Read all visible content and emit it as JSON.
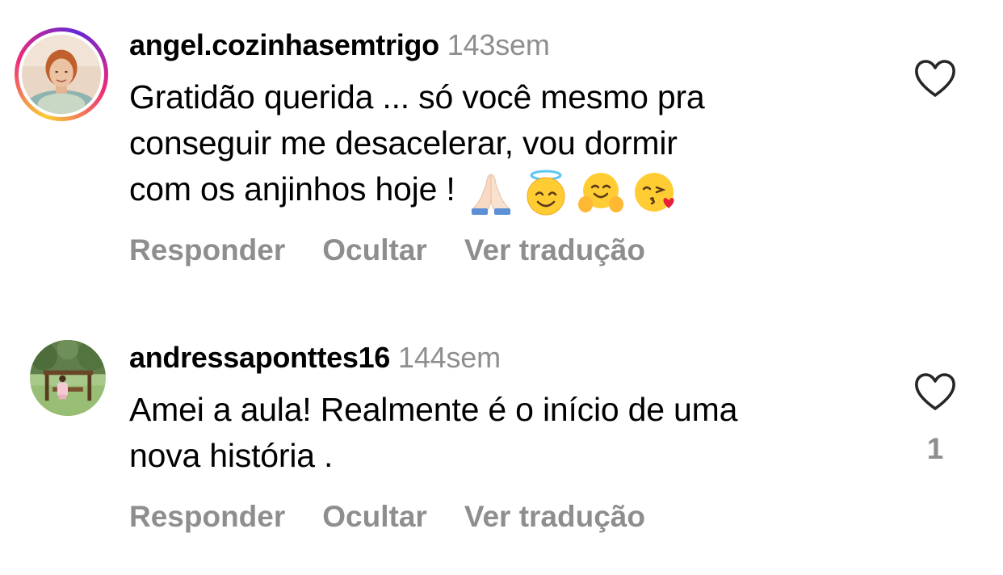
{
  "comments": [
    {
      "username": "angel.cozinhasemtrigo",
      "time": "143sem",
      "has_story_ring": true,
      "text_lines": [
        "Gratidão querida ... só você mesmo pra",
        "conseguir me desacelerar, vou dormir",
        "com os anjinhos hoje !"
      ],
      "emojis": [
        "folded-hands-emoji",
        "smiling-face-with-halo-emoji",
        "hugging-face-emoji",
        "face-blowing-kiss-emoji"
      ],
      "actions": {
        "reply": "Responder",
        "hide": "Ocultar",
        "translate": "Ver tradução"
      },
      "liked": false,
      "like_count": ""
    },
    {
      "username": "andressaponttes16",
      "time": "144sem",
      "has_story_ring": false,
      "text_lines": [
        "Amei a aula! Realmente é o início de uma",
        "nova história ."
      ],
      "emojis": [],
      "actions": {
        "reply": "Responder",
        "hide": "Ocultar",
        "translate": "Ver tradução"
      },
      "liked": false,
      "like_count": "1"
    }
  ],
  "colors": {
    "text": "#000000",
    "secondary": "#8e8e8e",
    "background": "#ffffff",
    "heart_outline": "#262626"
  },
  "icons": {
    "like": "heart-outline-icon"
  }
}
